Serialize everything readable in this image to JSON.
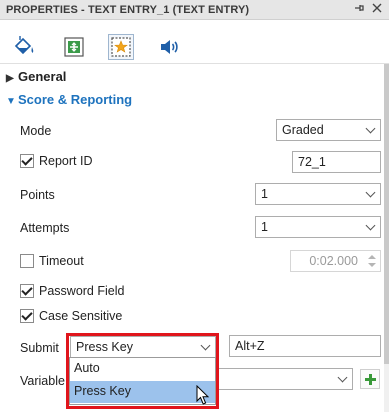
{
  "panel": {
    "title": "PROPERTIES - TEXT ENTRY_1 (TEXT ENTRY)",
    "pin_icon": "pin-icon",
    "close_icon": "close-icon"
  },
  "tabs": [
    {
      "icon": "fill-bucket-icon",
      "selected": false
    },
    {
      "icon": "position-size-icon",
      "selected": false
    },
    {
      "icon": "star-interaction-icon",
      "selected": true
    },
    {
      "icon": "speaker-audio-icon",
      "selected": false
    }
  ],
  "sections": {
    "general": {
      "label": "General",
      "expanded": false
    },
    "score": {
      "label": "Score & Reporting",
      "expanded": true
    }
  },
  "form": {
    "mode": {
      "label": "Mode",
      "value": "Graded"
    },
    "report_id": {
      "label": "Report ID",
      "checked": true,
      "value": "72_1"
    },
    "points": {
      "label": "Points",
      "value": "1"
    },
    "attempts": {
      "label": "Attempts",
      "value": "1"
    },
    "timeout": {
      "label": "Timeout",
      "checked": false,
      "value": "0:02.000"
    },
    "password_field": {
      "label": "Password Field",
      "checked": true
    },
    "case_sensitive": {
      "label": "Case Sensitive",
      "checked": true
    },
    "submit": {
      "label": "Submit",
      "value": "Press Key",
      "shortcut": "Alt+Z",
      "options": [
        "Auto",
        "Press Key"
      ],
      "highlighted_option": "Press Key"
    },
    "variable": {
      "label": "Variable",
      "value": ""
    }
  },
  "colors": {
    "accent": "#1e73be",
    "highlight_border": "#e0151c",
    "selected_option": "#9cc2ec",
    "add_green": "#3a9a3a"
  }
}
